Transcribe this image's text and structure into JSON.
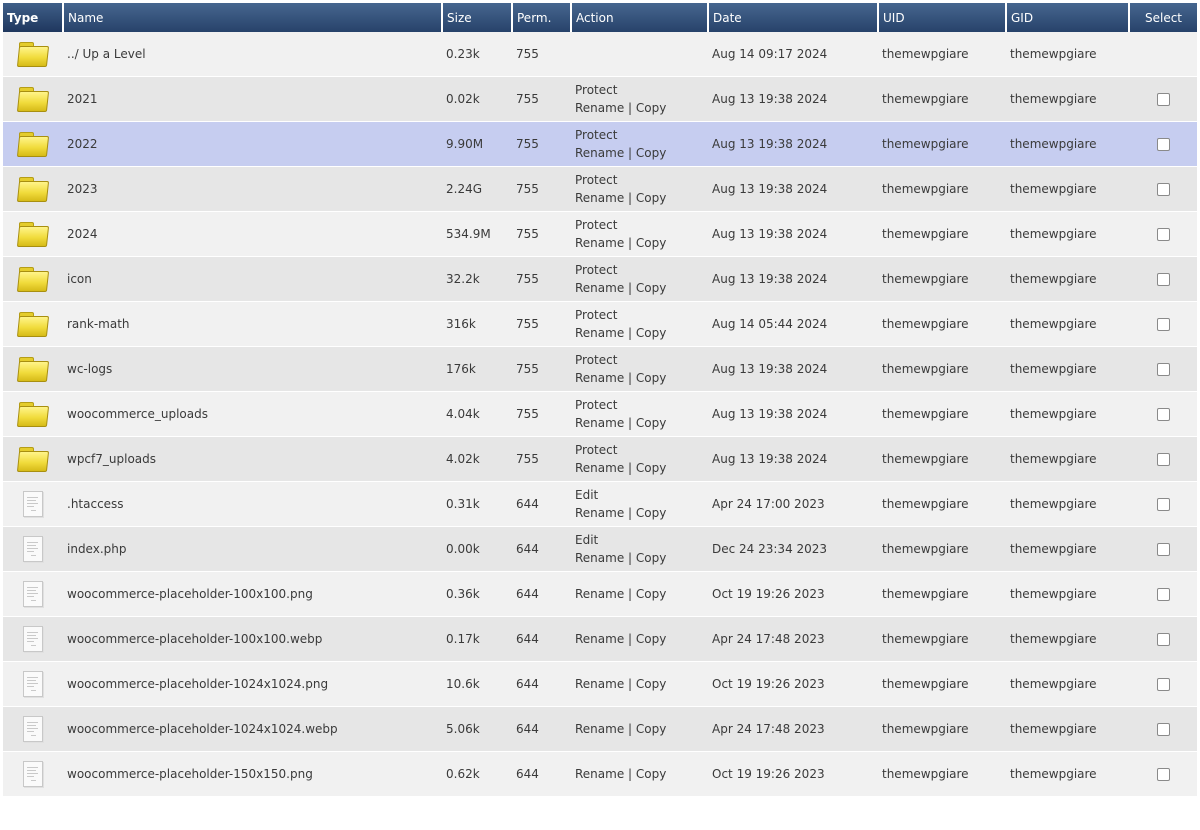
{
  "headers": {
    "type": "Type",
    "name": "Name",
    "size": "Size",
    "perm": "Perm.",
    "action": "Action",
    "date": "Date",
    "uid": "UID",
    "gid": "GID",
    "select": "Select"
  },
  "action_labels": {
    "protect": "Protect",
    "edit": "Edit",
    "rename": "Rename",
    "copy": "Copy",
    "separator": "|"
  },
  "colors": {
    "header_bg": "#2f4d78",
    "row_odd": "#f1f1f1",
    "row_even": "#e6e6e6",
    "row_highlight": "#c6cdf0",
    "folder": "#f1dc3d"
  },
  "rows": [
    {
      "type": "folder-icon",
      "name": "../ Up a Level",
      "size": "0.23k",
      "perm": "755",
      "primary_action": "",
      "file_actions": false,
      "date": "Aug 14 09:17 2024",
      "uid": "themewpgiare",
      "gid": "themewpgiare",
      "checkbox": false,
      "highlighted": false
    },
    {
      "type": "folder-icon",
      "name": "2021",
      "size": "0.02k",
      "perm": "755",
      "primary_action": "Protect",
      "file_actions": true,
      "date": "Aug 13 19:38 2024",
      "uid": "themewpgiare",
      "gid": "themewpgiare",
      "checkbox": true,
      "highlighted": false
    },
    {
      "type": "folder-icon",
      "name": "2022",
      "size": "9.90M",
      "perm": "755",
      "primary_action": "Protect",
      "file_actions": true,
      "date": "Aug 13 19:38 2024",
      "uid": "themewpgiare",
      "gid": "themewpgiare",
      "checkbox": true,
      "highlighted": true
    },
    {
      "type": "folder-icon",
      "name": "2023",
      "size": "2.24G",
      "perm": "755",
      "primary_action": "Protect",
      "file_actions": true,
      "date": "Aug 13 19:38 2024",
      "uid": "themewpgiare",
      "gid": "themewpgiare",
      "checkbox": true,
      "highlighted": false
    },
    {
      "type": "folder-icon",
      "name": "2024",
      "size": "534.9M",
      "perm": "755",
      "primary_action": "Protect",
      "file_actions": true,
      "date": "Aug 13 19:38 2024",
      "uid": "themewpgiare",
      "gid": "themewpgiare",
      "checkbox": true,
      "highlighted": false
    },
    {
      "type": "folder-icon",
      "name": "icon",
      "size": "32.2k",
      "perm": "755",
      "primary_action": "Protect",
      "file_actions": true,
      "date": "Aug 13 19:38 2024",
      "uid": "themewpgiare",
      "gid": "themewpgiare",
      "checkbox": true,
      "highlighted": false
    },
    {
      "type": "folder-icon",
      "name": "rank-math",
      "size": "316k",
      "perm": "755",
      "primary_action": "Protect",
      "file_actions": true,
      "date": "Aug 14 05:44 2024",
      "uid": "themewpgiare",
      "gid": "themewpgiare",
      "checkbox": true,
      "highlighted": false
    },
    {
      "type": "folder-icon",
      "name": "wc-logs",
      "size": "176k",
      "perm": "755",
      "primary_action": "Protect",
      "file_actions": true,
      "date": "Aug 13 19:38 2024",
      "uid": "themewpgiare",
      "gid": "themewpgiare",
      "checkbox": true,
      "highlighted": false
    },
    {
      "type": "folder-icon",
      "name": "woocommerce_uploads",
      "size": "4.04k",
      "perm": "755",
      "primary_action": "Protect",
      "file_actions": true,
      "date": "Aug 13 19:38 2024",
      "uid": "themewpgiare",
      "gid": "themewpgiare",
      "checkbox": true,
      "highlighted": false
    },
    {
      "type": "folder-icon",
      "name": "wpcf7_uploads",
      "size": "4.02k",
      "perm": "755",
      "primary_action": "Protect",
      "file_actions": true,
      "date": "Aug 13 19:38 2024",
      "uid": "themewpgiare",
      "gid": "themewpgiare",
      "checkbox": true,
      "highlighted": false
    },
    {
      "type": "file-icon",
      "name": ".htaccess",
      "size": "0.31k",
      "perm": "644",
      "primary_action": "Edit",
      "file_actions": true,
      "date": "Apr 24 17:00 2023",
      "uid": "themewpgiare",
      "gid": "themewpgiare",
      "checkbox": true,
      "highlighted": false
    },
    {
      "type": "file-icon",
      "name": "index.php",
      "size": "0.00k",
      "perm": "644",
      "primary_action": "Edit",
      "file_actions": true,
      "date": "Dec 24 23:34 2023",
      "uid": "themewpgiare",
      "gid": "themewpgiare",
      "checkbox": true,
      "highlighted": false
    },
    {
      "type": "file-icon",
      "name": "woocommerce-placeholder-100x100.png",
      "size": "0.36k",
      "perm": "644",
      "primary_action": "",
      "file_actions": true,
      "date": "Oct 19 19:26 2023",
      "uid": "themewpgiare",
      "gid": "themewpgiare",
      "checkbox": true,
      "highlighted": false
    },
    {
      "type": "file-icon",
      "name": "woocommerce-placeholder-100x100.webp",
      "size": "0.17k",
      "perm": "644",
      "primary_action": "",
      "file_actions": true,
      "date": "Apr 24 17:48 2023",
      "uid": "themewpgiare",
      "gid": "themewpgiare",
      "checkbox": true,
      "highlighted": false
    },
    {
      "type": "file-icon",
      "name": "woocommerce-placeholder-1024x1024.png",
      "size": "10.6k",
      "perm": "644",
      "primary_action": "",
      "file_actions": true,
      "date": "Oct 19 19:26 2023",
      "uid": "themewpgiare",
      "gid": "themewpgiare",
      "checkbox": true,
      "highlighted": false
    },
    {
      "type": "file-icon",
      "name": "woocommerce-placeholder-1024x1024.webp",
      "size": "5.06k",
      "perm": "644",
      "primary_action": "",
      "file_actions": true,
      "date": "Apr 24 17:48 2023",
      "uid": "themewpgiare",
      "gid": "themewpgiare",
      "checkbox": true,
      "highlighted": false
    },
    {
      "type": "file-icon",
      "name": "woocommerce-placeholder-150x150.png",
      "size": "0.62k",
      "perm": "644",
      "primary_action": "",
      "file_actions": true,
      "date": "Oct 19 19:26 2023",
      "uid": "themewpgiare",
      "gid": "themewpgiare",
      "checkbox": true,
      "highlighted": false
    }
  ]
}
